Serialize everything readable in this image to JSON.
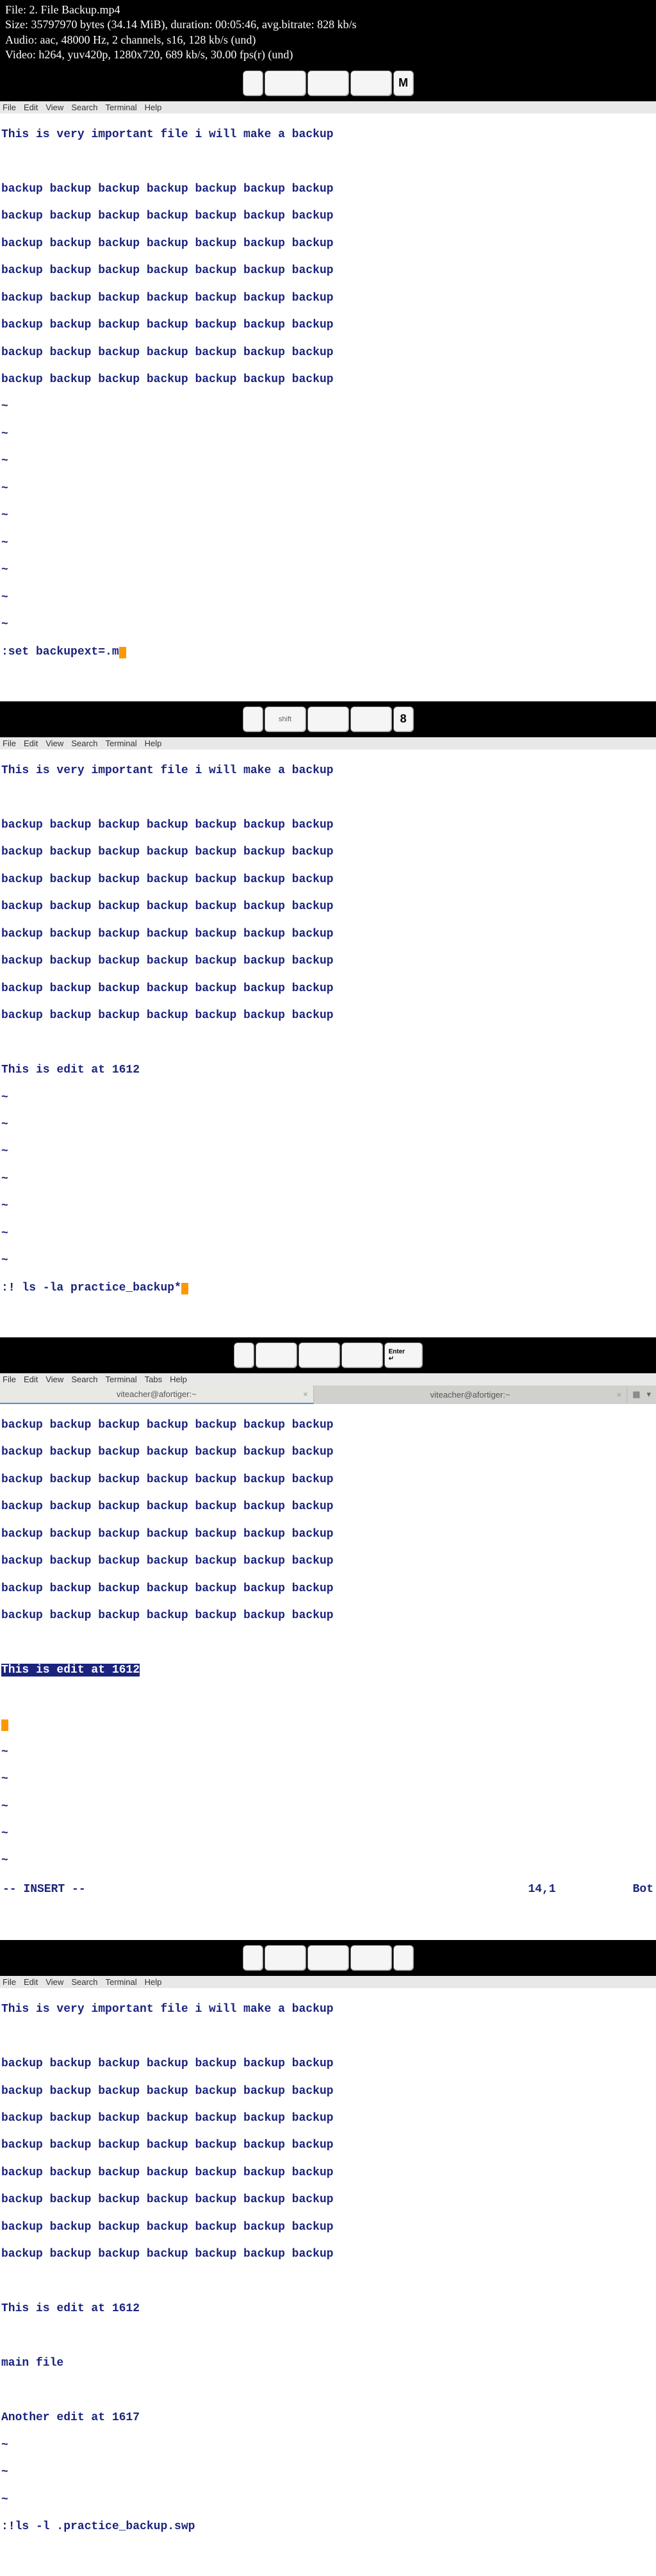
{
  "header": {
    "file_line": "File: 2. File Backup.mp4",
    "size_line": "Size: 35797970 bytes (34.14 MiB), duration: 00:05:46, avg.bitrate: 828 kb/s",
    "audio_line": "Audio: aac, 48000 Hz, 2 channels, s16, 128 kb/s (und)",
    "video_line": "Video: h264, yuv420p, 1280x720, 689 kb/s, 30.00 fps(r) (und)"
  },
  "menu": {
    "items": [
      "File",
      "Edit",
      "View",
      "Search",
      "Terminal",
      "Help"
    ]
  },
  "menu_tabs": {
    "items": [
      "File",
      "Edit",
      "View",
      "Search",
      "Terminal",
      "Tabs",
      "Help"
    ]
  },
  "tabs": {
    "tab1": "viteacher@afortiger:~",
    "tab2": "viteacher@afortiger:~"
  },
  "content": {
    "title_line": "This is very important file i will make a backup",
    "backup_row": "backup backup backup backup backup backup backup",
    "edit_1612": "This is edit at 1612",
    "main_file": "main file",
    "edit_1617": "Another edit at 1617"
  },
  "commands": {
    "cmd1": ":set backupext=.m",
    "cmd2": ":! ls -la practice_backup*",
    "cmd4": ":!ls -l .practice_backup.swp"
  },
  "status": {
    "insert": "-- INSERT --",
    "pos": "14,1",
    "loc": "Bot"
  },
  "keys": {
    "shift": "shift",
    "m": "M",
    "eight": "8",
    "enter": "Enter",
    "enter_sym": "↵"
  },
  "tilde": "~"
}
